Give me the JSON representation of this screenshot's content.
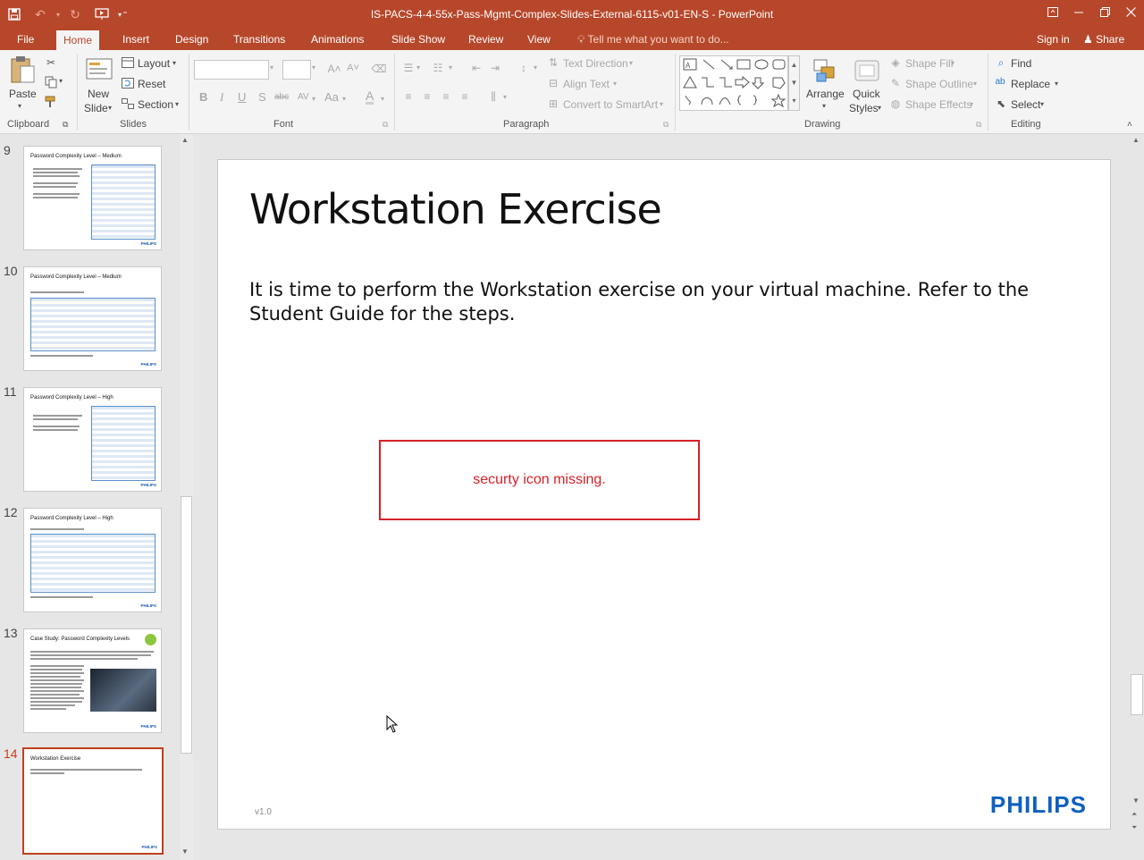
{
  "app": {
    "doc_title": "IS-PACS-4-4-55x-Pass-Mgmt-Complex-Slides-External-6115-v01-EN-S - PowerPoint",
    "sign_in": "Sign in",
    "share": "Share",
    "tell_me": "Tell me what you want to do..."
  },
  "tabs": [
    "File",
    "Home",
    "Insert",
    "Design",
    "Transitions",
    "Animations",
    "Slide Show",
    "Review",
    "View"
  ],
  "ribbon": {
    "clipboard": {
      "paste": "Paste",
      "label": "Clipboard"
    },
    "slides": {
      "new_slide_1": "New",
      "new_slide_2": "Slide",
      "layout": "Layout",
      "reset": "Reset",
      "section": "Section",
      "label": "Slides"
    },
    "font": {
      "label": "Font",
      "bold": "B",
      "italic": "I",
      "underline": "U",
      "shadow": "S",
      "strike": "abc",
      "spacing": "AV",
      "case": "Aa",
      "color": "A"
    },
    "paragraph": {
      "text_direction": "Text Direction",
      "align_text": "Align Text",
      "smartart": "Convert to SmartArt",
      "label": "Paragraph"
    },
    "drawing": {
      "arrange": "Arrange",
      "quick_styles_1": "Quick",
      "quick_styles_2": "Styles",
      "shape_fill": "Shape Fill",
      "shape_outline": "Shape Outline",
      "shape_effects": "Shape Effects",
      "label": "Drawing"
    },
    "editing": {
      "find": "Find",
      "replace": "Replace",
      "select": "Select",
      "label": "Editing"
    }
  },
  "thumbnails": [
    {
      "num": "9",
      "title": "Password Complexity Level – Medium"
    },
    {
      "num": "10",
      "title": "Password Complexity Level – Medium"
    },
    {
      "num": "11",
      "title": "Password Complexity Level – High"
    },
    {
      "num": "12",
      "title": "Password Complexity Level – High"
    },
    {
      "num": "13",
      "title": "Case Study: Password Complexity Levels"
    },
    {
      "num": "14",
      "title": "Workstation Exercise"
    }
  ],
  "slide": {
    "title": "Workstation Exercise",
    "body": "It is time to perform the Workstation exercise on your virtual machine. Refer to the Student Guide for the steps.",
    "placeholder_text": "securty icon missing.",
    "version": "v1.0",
    "logo": "PHILIPS"
  },
  "colors": {
    "accent": "#b7472a",
    "placeholder_red": "#d62027",
    "logo_blue": "#0e5fc0"
  }
}
